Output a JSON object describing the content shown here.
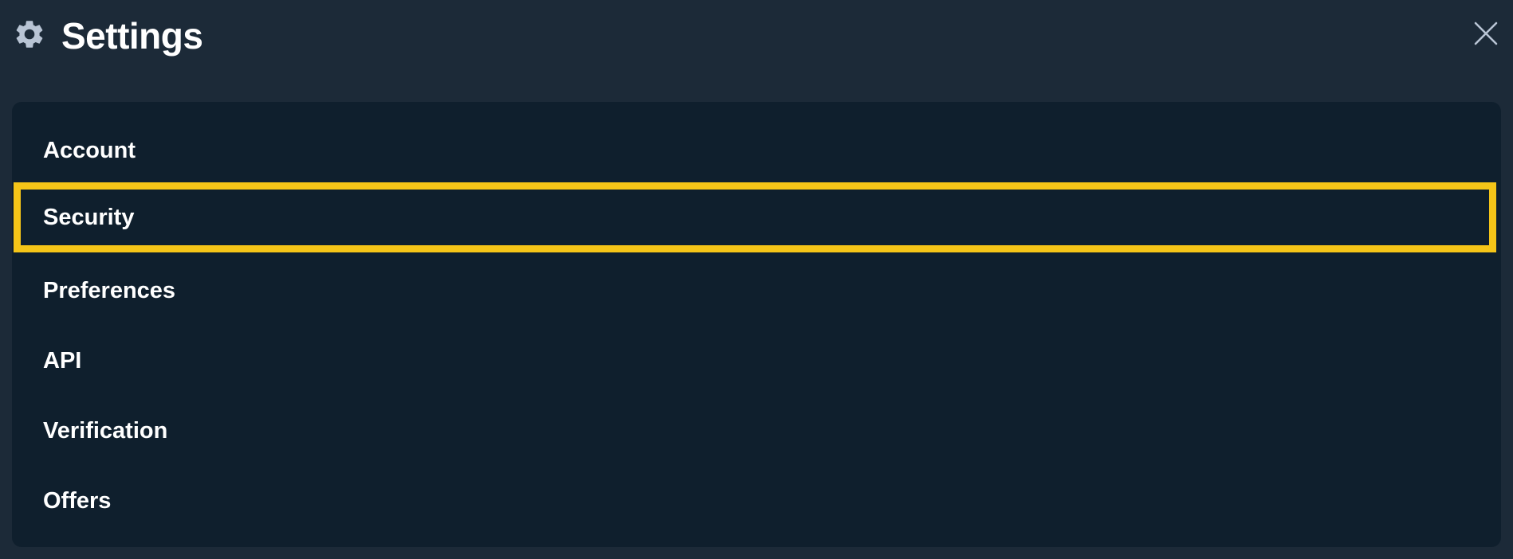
{
  "header": {
    "title": "Settings",
    "gear_icon": "gear-icon",
    "close_icon": "close-icon"
  },
  "menu": {
    "items": [
      {
        "label": "Account",
        "selected": false
      },
      {
        "label": "Security",
        "selected": true
      },
      {
        "label": "Preferences",
        "selected": false
      },
      {
        "label": "API",
        "selected": false
      },
      {
        "label": "Verification",
        "selected": false
      },
      {
        "label": "Offers",
        "selected": false
      }
    ]
  },
  "colors": {
    "background": "#1c2a38",
    "panel": "#0f1f2d",
    "highlight": "#f5c518",
    "icon": "#b8c4d4",
    "text": "#ffffff"
  }
}
